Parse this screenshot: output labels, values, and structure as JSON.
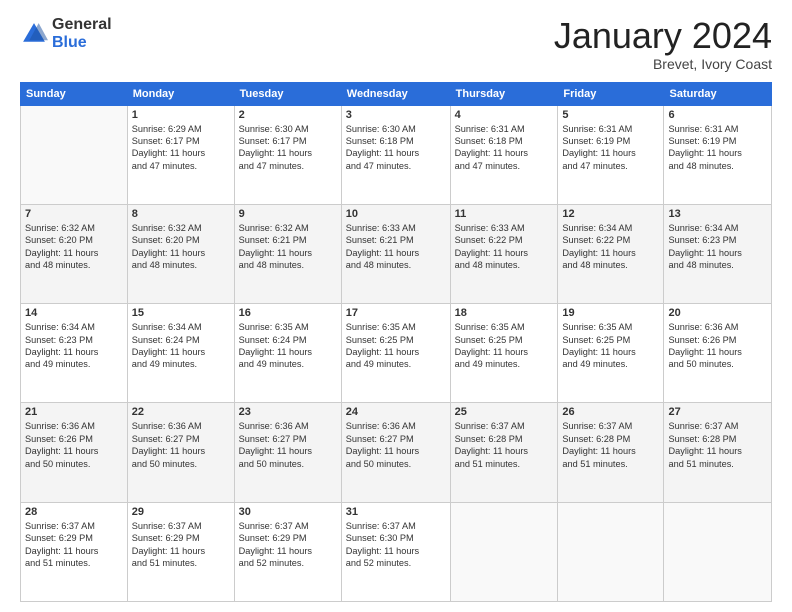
{
  "header": {
    "logo_general": "General",
    "logo_blue": "Blue",
    "month_title": "January 2024",
    "subtitle": "Brevet, Ivory Coast"
  },
  "days_of_week": [
    "Sunday",
    "Monday",
    "Tuesday",
    "Wednesday",
    "Thursday",
    "Friday",
    "Saturday"
  ],
  "weeks": [
    [
      {
        "day": "",
        "text": ""
      },
      {
        "day": "1",
        "text": "Sunrise: 6:29 AM\nSunset: 6:17 PM\nDaylight: 11 hours\nand 47 minutes."
      },
      {
        "day": "2",
        "text": "Sunrise: 6:30 AM\nSunset: 6:17 PM\nDaylight: 11 hours\nand 47 minutes."
      },
      {
        "day": "3",
        "text": "Sunrise: 6:30 AM\nSunset: 6:18 PM\nDaylight: 11 hours\nand 47 minutes."
      },
      {
        "day": "4",
        "text": "Sunrise: 6:31 AM\nSunset: 6:18 PM\nDaylight: 11 hours\nand 47 minutes."
      },
      {
        "day": "5",
        "text": "Sunrise: 6:31 AM\nSunset: 6:19 PM\nDaylight: 11 hours\nand 47 minutes."
      },
      {
        "day": "6",
        "text": "Sunrise: 6:31 AM\nSunset: 6:19 PM\nDaylight: 11 hours\nand 48 minutes."
      }
    ],
    [
      {
        "day": "7",
        "text": "Sunrise: 6:32 AM\nSunset: 6:20 PM\nDaylight: 11 hours\nand 48 minutes."
      },
      {
        "day": "8",
        "text": "Sunrise: 6:32 AM\nSunset: 6:20 PM\nDaylight: 11 hours\nand 48 minutes."
      },
      {
        "day": "9",
        "text": "Sunrise: 6:32 AM\nSunset: 6:21 PM\nDaylight: 11 hours\nand 48 minutes."
      },
      {
        "day": "10",
        "text": "Sunrise: 6:33 AM\nSunset: 6:21 PM\nDaylight: 11 hours\nand 48 minutes."
      },
      {
        "day": "11",
        "text": "Sunrise: 6:33 AM\nSunset: 6:22 PM\nDaylight: 11 hours\nand 48 minutes."
      },
      {
        "day": "12",
        "text": "Sunrise: 6:34 AM\nSunset: 6:22 PM\nDaylight: 11 hours\nand 48 minutes."
      },
      {
        "day": "13",
        "text": "Sunrise: 6:34 AM\nSunset: 6:23 PM\nDaylight: 11 hours\nand 48 minutes."
      }
    ],
    [
      {
        "day": "14",
        "text": "Sunrise: 6:34 AM\nSunset: 6:23 PM\nDaylight: 11 hours\nand 49 minutes."
      },
      {
        "day": "15",
        "text": "Sunrise: 6:34 AM\nSunset: 6:24 PM\nDaylight: 11 hours\nand 49 minutes."
      },
      {
        "day": "16",
        "text": "Sunrise: 6:35 AM\nSunset: 6:24 PM\nDaylight: 11 hours\nand 49 minutes."
      },
      {
        "day": "17",
        "text": "Sunrise: 6:35 AM\nSunset: 6:25 PM\nDaylight: 11 hours\nand 49 minutes."
      },
      {
        "day": "18",
        "text": "Sunrise: 6:35 AM\nSunset: 6:25 PM\nDaylight: 11 hours\nand 49 minutes."
      },
      {
        "day": "19",
        "text": "Sunrise: 6:35 AM\nSunset: 6:25 PM\nDaylight: 11 hours\nand 49 minutes."
      },
      {
        "day": "20",
        "text": "Sunrise: 6:36 AM\nSunset: 6:26 PM\nDaylight: 11 hours\nand 50 minutes."
      }
    ],
    [
      {
        "day": "21",
        "text": "Sunrise: 6:36 AM\nSunset: 6:26 PM\nDaylight: 11 hours\nand 50 minutes."
      },
      {
        "day": "22",
        "text": "Sunrise: 6:36 AM\nSunset: 6:27 PM\nDaylight: 11 hours\nand 50 minutes."
      },
      {
        "day": "23",
        "text": "Sunrise: 6:36 AM\nSunset: 6:27 PM\nDaylight: 11 hours\nand 50 minutes."
      },
      {
        "day": "24",
        "text": "Sunrise: 6:36 AM\nSunset: 6:27 PM\nDaylight: 11 hours\nand 50 minutes."
      },
      {
        "day": "25",
        "text": "Sunrise: 6:37 AM\nSunset: 6:28 PM\nDaylight: 11 hours\nand 51 minutes."
      },
      {
        "day": "26",
        "text": "Sunrise: 6:37 AM\nSunset: 6:28 PM\nDaylight: 11 hours\nand 51 minutes."
      },
      {
        "day": "27",
        "text": "Sunrise: 6:37 AM\nSunset: 6:28 PM\nDaylight: 11 hours\nand 51 minutes."
      }
    ],
    [
      {
        "day": "28",
        "text": "Sunrise: 6:37 AM\nSunset: 6:29 PM\nDaylight: 11 hours\nand 51 minutes."
      },
      {
        "day": "29",
        "text": "Sunrise: 6:37 AM\nSunset: 6:29 PM\nDaylight: 11 hours\nand 51 minutes."
      },
      {
        "day": "30",
        "text": "Sunrise: 6:37 AM\nSunset: 6:29 PM\nDaylight: 11 hours\nand 52 minutes."
      },
      {
        "day": "31",
        "text": "Sunrise: 6:37 AM\nSunset: 6:30 PM\nDaylight: 11 hours\nand 52 minutes."
      },
      {
        "day": "",
        "text": ""
      },
      {
        "day": "",
        "text": ""
      },
      {
        "day": "",
        "text": ""
      }
    ]
  ]
}
